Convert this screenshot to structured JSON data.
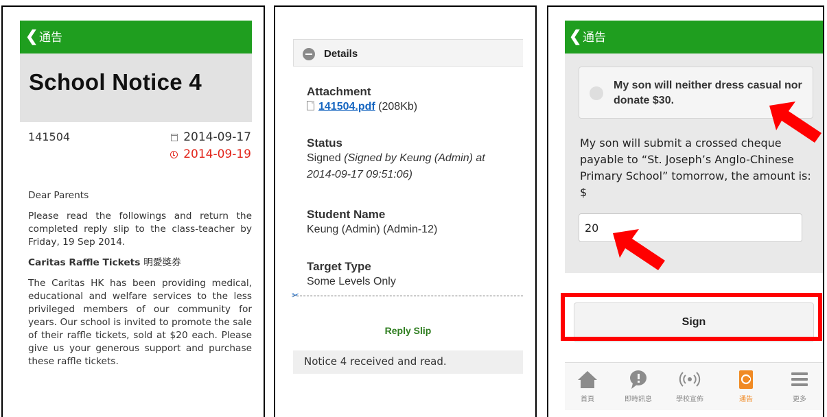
{
  "panel1": {
    "header": {
      "back_glyph": "❮",
      "title": "通告"
    },
    "notice_title": "School Notice 4",
    "notice_number": "141504",
    "issue_date": "2014-09-17",
    "due_date": "2014-09-19",
    "salutation": "Dear Parents",
    "paragraph1": "Please read the followings and return the completed reply slip to the class-teacher by Friday, 19 Sep 2014.",
    "caritas_heading": "Caritas Raffle Tickets",
    "caritas_heading_zh": "明愛獎券",
    "paragraph2": "The Caritas HK has been providing medical, educational and welfare services to the less privileged members of our community for years. Our school is invited to promote the sale of their raffle tickets, sold at $20 each. Please give us your generous support and purchase these raffle tickets."
  },
  "panel2": {
    "details_label": "Details",
    "attachment_label": "Attachment",
    "attachment_file": "141504.pdf",
    "attachment_size": "(208Kb)",
    "status_label": "Status",
    "status_value": "Signed",
    "status_detail": "(Signed by Keung (Admin) at 2014-09-17 09:51:06)",
    "student_name_label": "Student Name",
    "student_name_value": "Keung (Admin) (Admin-12)",
    "target_type_label": "Target Type",
    "target_type_value": "Some Levels Only",
    "scissors_glyph": "✂",
    "reply_slip_label": "Reply Slip",
    "reply_message": "Notice 4 received and read."
  },
  "panel3": {
    "header": {
      "back_glyph": "❮",
      "title": "通告"
    },
    "option_text": "My son will neither dress casual nor donate $30.",
    "question_text": "My son will submit a crossed cheque payable to “St. Joseph’s Anglo-Chinese Primary School” tomorrow, the amount is: $",
    "amount_value": "20",
    "sign_label": "Sign",
    "tabs": [
      {
        "label": "首頁",
        "icon": "home-icon"
      },
      {
        "label": "即時訊息",
        "icon": "chat-bubble-icon"
      },
      {
        "label": "學校宣佈",
        "icon": "broadcast-icon"
      },
      {
        "label": "通告",
        "icon": "notice-icon",
        "active": true
      },
      {
        "label": "更多",
        "icon": "menu-icon"
      }
    ]
  },
  "colors": {
    "header_green": "#1f9e1f",
    "due_red": "#e2261c",
    "link_blue": "#1565c0",
    "annotation_red": "#ff0000",
    "active_tab": "#f08a24"
  }
}
